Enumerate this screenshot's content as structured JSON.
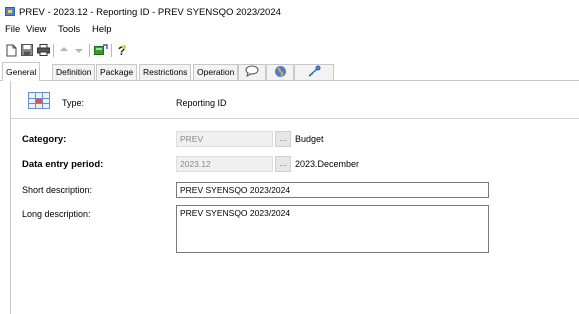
{
  "window": {
    "title": "PREV - 2023.12 - Reporting ID - PREV SYENSQO 2023/2024"
  },
  "menu": [
    "File",
    "View",
    "Tools",
    "Help"
  ],
  "toolbar": {
    "icons": [
      "new-document-icon",
      "save-icon",
      "print-icon",
      "arrow-up-icon",
      "arrow-down-icon",
      "export-icon",
      "help-icon"
    ]
  },
  "tabs": [
    "General",
    "Definition",
    "Package",
    "Restrictions",
    "Operation"
  ],
  "tab_icons": [
    "comment-icon",
    "globe-icon",
    "key-icon"
  ],
  "form": {
    "type_label": "Type:",
    "type_value": "Reporting ID",
    "category_label": "Category:",
    "category_value": "PREV",
    "category_desc": "Budget",
    "period_label": "Data entry period:",
    "period_value": "2023.12",
    "period_desc": "2023.December",
    "short_desc_label": "Short description:",
    "short_desc_value": "PREV SYENSQO 2023/2024",
    "long_desc_label": "Long description:",
    "long_desc_value": "PREV SYENSQO 2023/2024",
    "browse_label": "..."
  }
}
